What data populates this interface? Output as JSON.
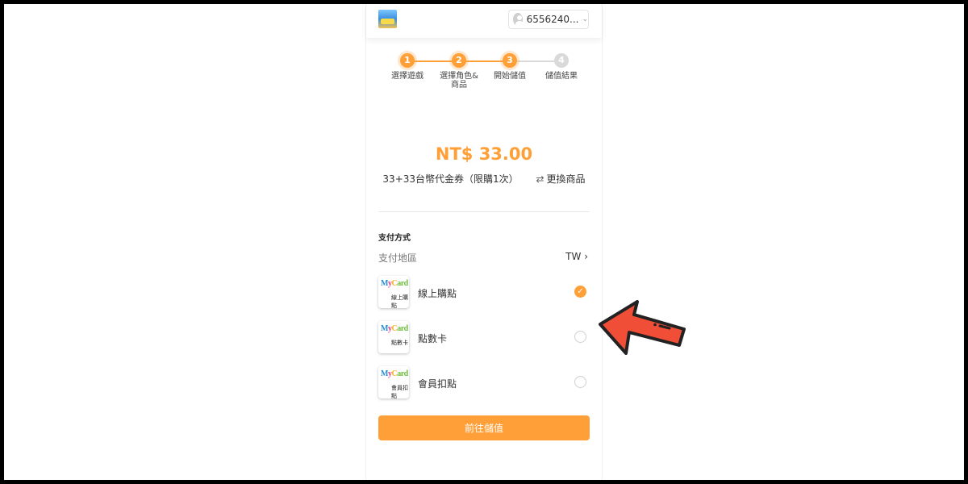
{
  "colors": {
    "accent": "#FF9F38",
    "inactive_step": "#D9D9D9",
    "arrow_fill": "#F04E37",
    "arrow_stroke": "#222222"
  },
  "header": {
    "game_icon": "game-thumbnail",
    "account_id": "6556240...",
    "dropdown_icon": "chevron-down-icon"
  },
  "steps": [
    {
      "number": "1",
      "label": "選擇遊戲",
      "state": "done"
    },
    {
      "number": "2",
      "label": "選擇角色&商品",
      "state": "done"
    },
    {
      "number": "3",
      "label": "開始儲值",
      "state": "current"
    },
    {
      "number": "4",
      "label": "儲值結果",
      "state": "pending"
    }
  ],
  "order": {
    "price": "NT$ 33.00",
    "product_name": "33+33台幣代金券（限購1次）",
    "change_label": "更換商品",
    "change_icon": "swap-icon"
  },
  "payment": {
    "section_title": "支付方式",
    "region_label": "支付地區",
    "region_value": "TW",
    "region_icon": "chevron-right-icon",
    "methods": [
      {
        "name": "線上購點",
        "logo_text": "MyCard",
        "logo_sub": "線上購點",
        "selected": true
      },
      {
        "name": "點數卡",
        "logo_text": "MyCard",
        "logo_sub": "點數卡",
        "selected": false
      },
      {
        "name": "會員扣點",
        "logo_text": "MyCard",
        "logo_sub": "會員扣點",
        "selected": false
      }
    ]
  },
  "submit_label": "前往儲值",
  "annotation": {
    "icon": "pointing-arrow-icon"
  }
}
